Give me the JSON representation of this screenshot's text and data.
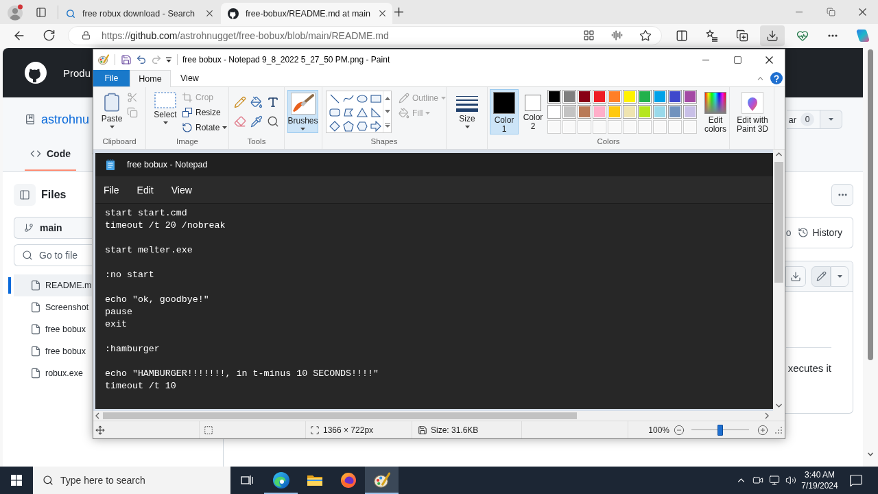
{
  "browser": {
    "tabs": [
      {
        "title": "free robux download - Search",
        "selected": false
      },
      {
        "title": "free-bobux/README.md at main",
        "selected": true
      }
    ],
    "address": {
      "scheme": "https://",
      "host": "github.com",
      "path": "/astrohnugget/free-bobux/blob/main/README.md"
    },
    "toolbar": [
      {
        "selected": false
      },
      {
        "selected": false
      },
      {
        "selected": false
      },
      {
        "selected": true
      },
      {
        "selected": false
      },
      {
        "selected": false
      },
      {
        "selected": false
      }
    ]
  },
  "github": {
    "header": {
      "nav": "Produ"
    },
    "repo": {
      "owner": "astrohnu",
      "star": {
        "label": "ar",
        "count": "0"
      }
    },
    "tabs": [
      {
        "label": "Code",
        "selected": true
      }
    ],
    "sidebar": {
      "title": "Files",
      "branch": "main",
      "search": {
        "placeholder": "Go to file"
      },
      "files": [
        {
          "name": "README.m",
          "selected": true
        },
        {
          "name": "Screenshot",
          "selected": false
        },
        {
          "name": "free bobux",
          "selected": false
        },
        {
          "name": "free bobux",
          "selected": false
        },
        {
          "name": "robux.exe",
          "selected": false
        }
      ]
    },
    "history": {
      "fragment": "o",
      "label": "History"
    },
    "readme": {
      "fragment": "xecutes it"
    }
  },
  "paint": {
    "title": "free bobux - Notepad 9_8_2022 5_27_50 PM.png - Paint",
    "undo": {
      "disabled": false
    },
    "redo": {
      "disabled": true
    },
    "ribbon_tabs": [
      {
        "label": "File",
        "kind": "menu",
        "selected": false
      },
      {
        "label": "Home",
        "kind": "tab",
        "selected": true
      },
      {
        "label": "View",
        "kind": "tab",
        "selected": false
      }
    ],
    "clipboard": {
      "label": "Clipboard",
      "paste": "Paste",
      "cut": {
        "disabled": true
      },
      "copy": {
        "disabled": true
      }
    },
    "image": {
      "label": "Image",
      "select": "Select",
      "crop": {
        "label": "Crop",
        "disabled": true
      },
      "resize": {
        "label": "Resize",
        "disabled": false
      },
      "rotate": {
        "label": "Rotate",
        "disabled": false
      }
    },
    "tools": {
      "label": "Tools"
    },
    "brushes": {
      "label": "Brushes",
      "selected": true
    },
    "shapes": {
      "label": "Shapes",
      "outline": {
        "label": "Outline",
        "disabled": true
      },
      "fill": {
        "label": "Fill",
        "disabled": true
      }
    },
    "size": {
      "label": "Size"
    },
    "colors": {
      "label": "Colors",
      "color1": {
        "label": "Color 1",
        "color": "#000000",
        "selected": true
      },
      "color2": {
        "label": "Color 2",
        "color": "#ffffff",
        "selected": false
      },
      "palette": [
        {
          "kind": "color",
          "color": "#000000"
        },
        {
          "kind": "color",
          "color": "#7f7f7f"
        },
        {
          "kind": "color",
          "color": "#880015"
        },
        {
          "kind": "color",
          "color": "#ed1c24"
        },
        {
          "kind": "color",
          "color": "#ff7f27"
        },
        {
          "kind": "color",
          "color": "#fff200"
        },
        {
          "kind": "color",
          "color": "#22b14c"
        },
        {
          "kind": "color",
          "color": "#00a2e8"
        },
        {
          "kind": "color",
          "color": "#3f48cc"
        },
        {
          "kind": "color",
          "color": "#a349a4"
        },
        {
          "kind": "color",
          "color": "#ffffff"
        },
        {
          "kind": "color",
          "color": "#c3c3c3"
        },
        {
          "kind": "color",
          "color": "#b97a57"
        },
        {
          "kind": "color",
          "color": "#ffaec9"
        },
        {
          "kind": "color",
          "color": "#ffc90e"
        },
        {
          "kind": "color",
          "color": "#efe4b0"
        },
        {
          "kind": "color",
          "color": "#b5e61d"
        },
        {
          "kind": "color",
          "color": "#99d9ea"
        },
        {
          "kind": "color",
          "color": "#7092be"
        },
        {
          "kind": "color",
          "color": "#c8bfe7"
        },
        {
          "kind": "empty"
        },
        {
          "kind": "empty"
        },
        {
          "kind": "empty"
        },
        {
          "kind": "empty"
        },
        {
          "kind": "empty"
        },
        {
          "kind": "empty"
        },
        {
          "kind": "empty"
        },
        {
          "kind": "empty"
        },
        {
          "kind": "empty"
        },
        {
          "kind": "empty"
        }
      ],
      "edit": "Edit colors"
    },
    "paint3d": "Edit with Paint 3D",
    "notepad": {
      "title": "free bobux - Notepad",
      "menu": [
        "File",
        "Edit",
        "View"
      ],
      "text": "start start.cmd\ntimeout /t 20 /nobreak\n\nstart melter.exe\n\n:no start\n\necho \"ok, goodbye!\"\npause\nexit\n\n:hamburger\n\necho \"HAMBURGER!!!!!!!, in t-minus 10 SECONDS!!!!\"\ntimeout /t 10"
    },
    "status": {
      "dimensions": "1366 × 722px",
      "file_size": "Size: 31.6KB",
      "zoom": {
        "label": "100%",
        "level": 0.5
      }
    }
  },
  "taskbar": {
    "search": {
      "placeholder": "Type here to search"
    },
    "apps": [
      {
        "selected": false,
        "running": true
      },
      {
        "selected": false,
        "running": false
      },
      {
        "selected": false,
        "running": false
      },
      {
        "selected": true,
        "running": true
      }
    ],
    "clock": {
      "time": "3:40 AM",
      "date": "7/19/2024"
    }
  }
}
